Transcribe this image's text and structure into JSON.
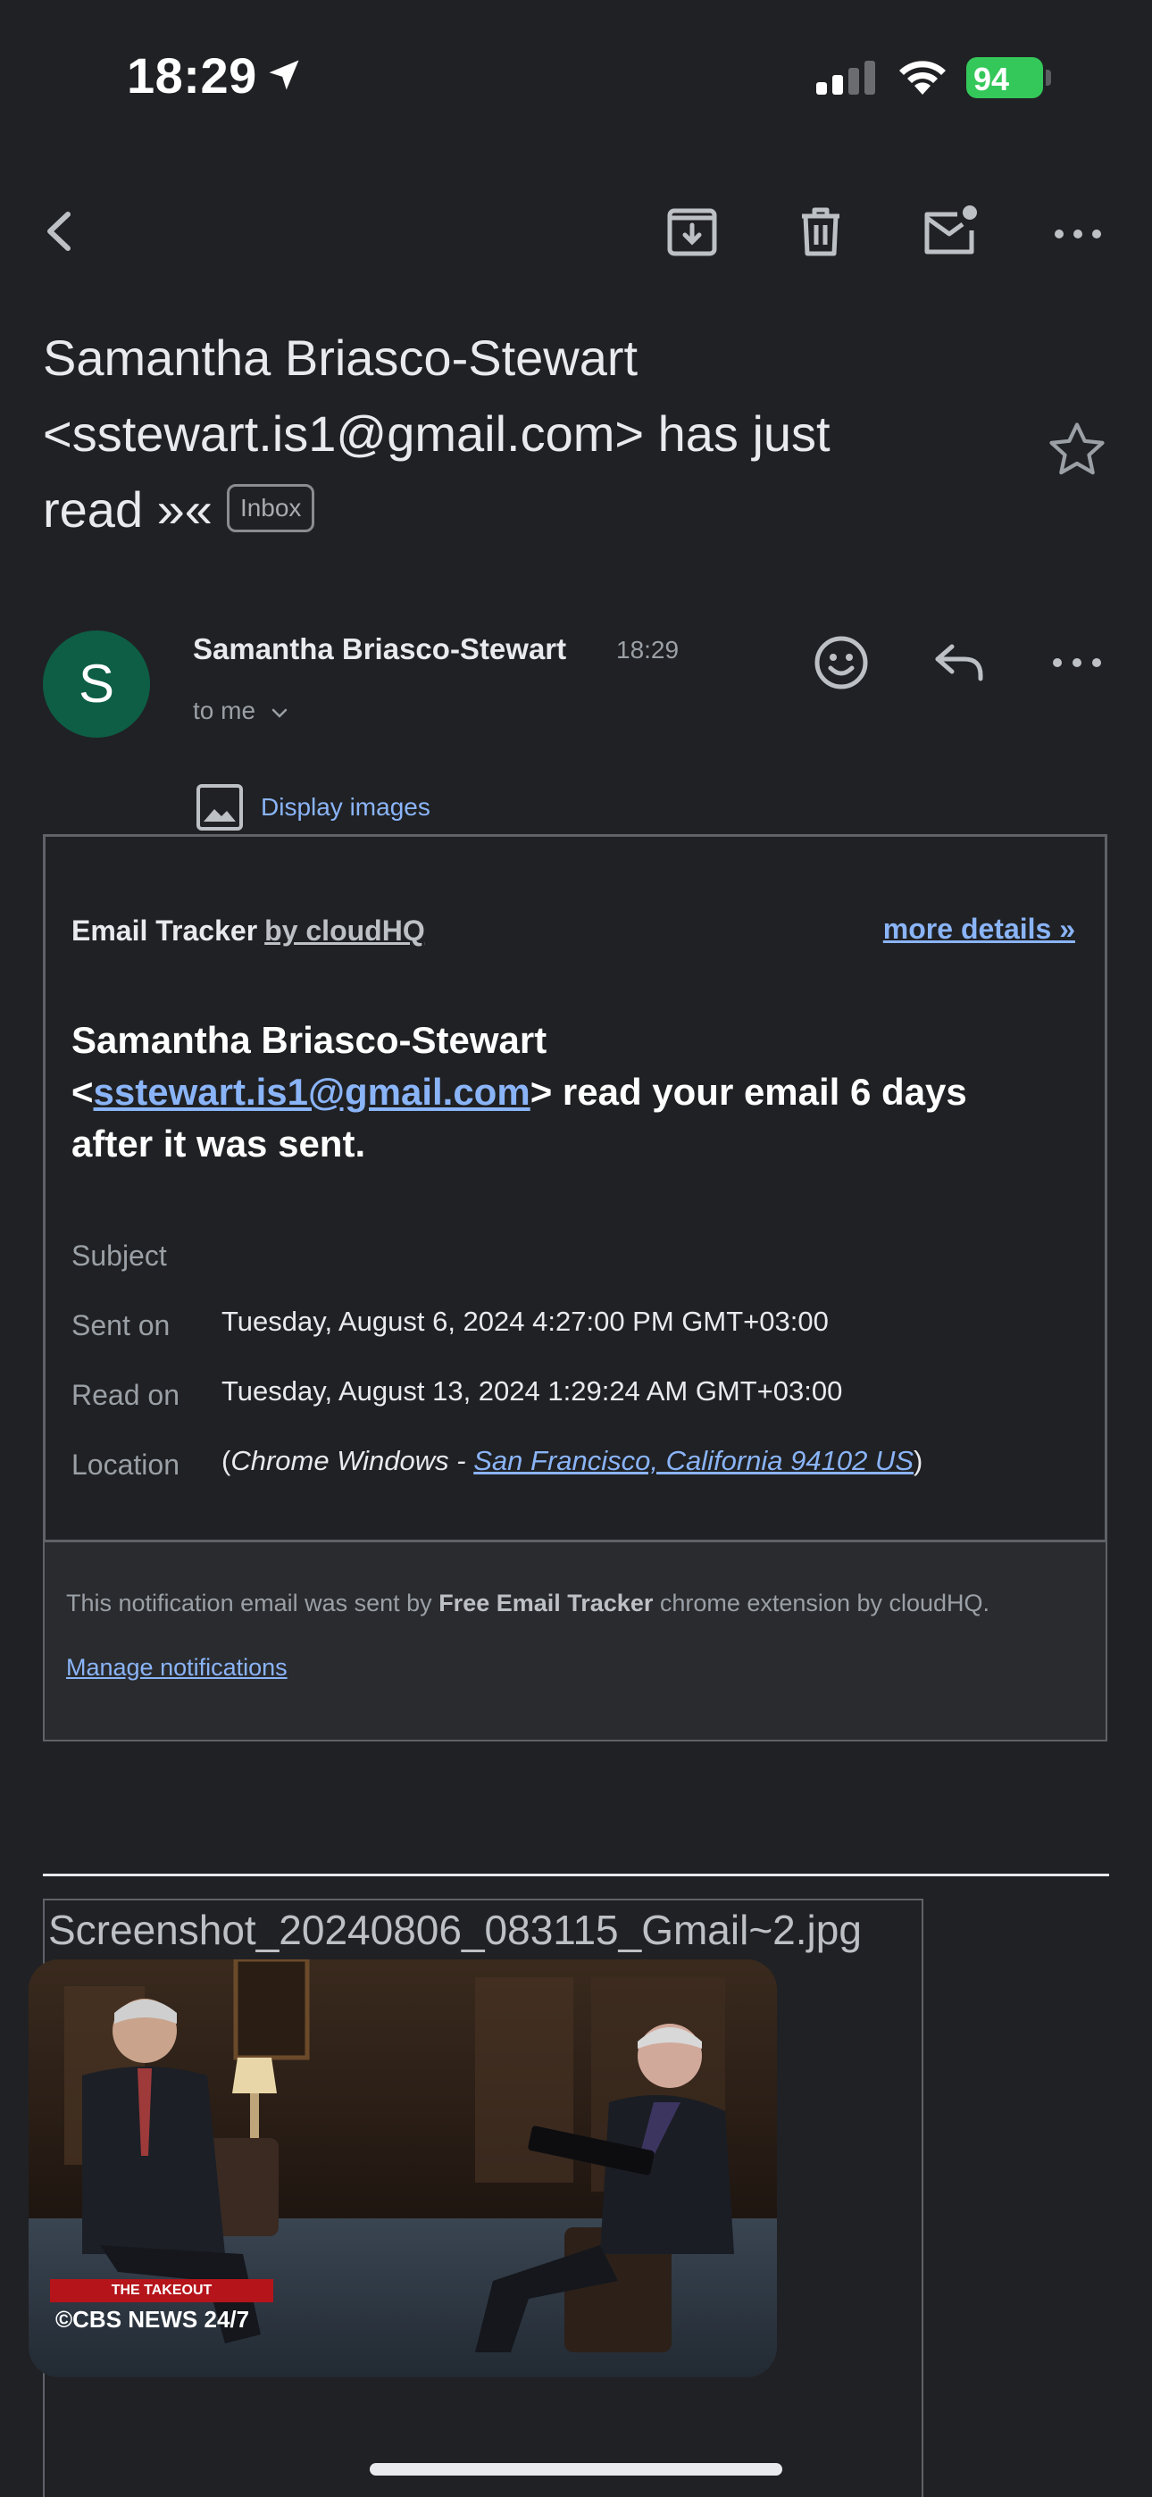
{
  "status_bar": {
    "time": "18:29",
    "battery": "94"
  },
  "toolbar": {
    "icons": [
      "back-icon",
      "archive-icon",
      "trash-icon",
      "mark-unread-icon",
      "more-icon"
    ]
  },
  "subject": {
    "text": "Samantha Briasco-Stewart <sstewart.is1@gmail.com> has  just read »«",
    "label": "Inbox"
  },
  "message": {
    "avatar_letter": "S",
    "sender": "Samantha Briasco-Stewart",
    "time": "18:29",
    "to": "to me",
    "display_images": "Display images"
  },
  "tracker": {
    "title": "Email Tracker",
    "title_by": "by cloudHQ",
    "more_details": "more details »",
    "headline_name": "Samantha Briasco-Stewart",
    "headline_lt": "<",
    "headline_email": "sstewart.is1@gmail.com",
    "headline_rest": "> read your email 6 days after it was sent.",
    "rows": {
      "subject_label": "Subject",
      "sent_label": "Sent on",
      "sent_value": "Tuesday, August 6, 2024 4:27:00 PM GMT+03:00",
      "read_label": "Read on",
      "read_value": "Tuesday, August 13, 2024 1:29:24 AM GMT+03:00",
      "location_label": "Location",
      "location_open": "(",
      "location_prefix": "Chrome Windows - ",
      "location_link": "San Francisco, California 94102 US",
      "location_close": ")"
    },
    "footer_pre": "This notification email was sent by ",
    "footer_bold": "Free Email Tracker",
    "footer_post": " chrome extension by cloudHQ.",
    "manage": "Manage notifications"
  },
  "attachment": {
    "filename": "Screenshot_20240806_083115_Gmail~2.jpg"
  },
  "video": {
    "banner": "THE TAKEOUT",
    "brand": "©CBS NEWS 24/7"
  }
}
